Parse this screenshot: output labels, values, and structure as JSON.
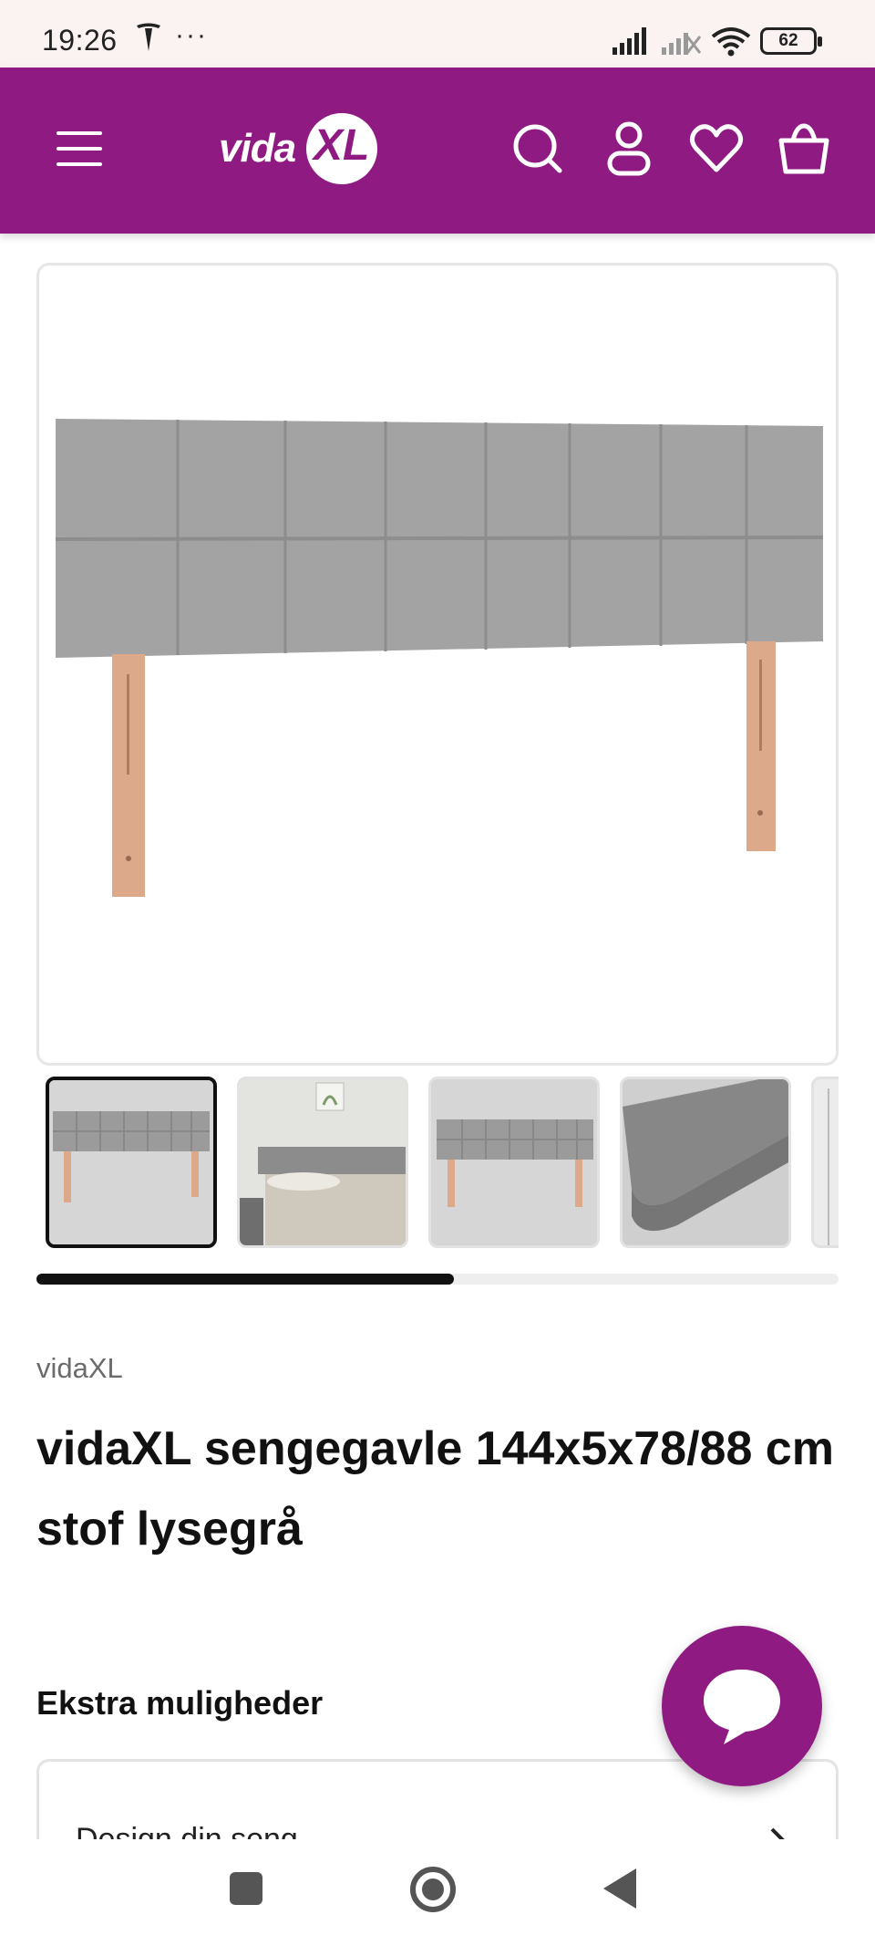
{
  "status_bar": {
    "time": "19:26",
    "more": "···",
    "battery": "62"
  },
  "header": {
    "logo_text": "vida",
    "logo_xl": "XL",
    "brand_color": "#8f1b82",
    "icons": [
      "menu-icon",
      "search-icon",
      "account-icon",
      "heart-icon",
      "basket-icon"
    ]
  },
  "gallery": {
    "thumbnails": [
      "headboard-front",
      "bedroom-scene",
      "headboard-front-alt",
      "fabric-detail",
      "partial-next"
    ],
    "active_index": 0,
    "scroll_progress": 0.52
  },
  "product": {
    "brand": "vidaXL",
    "title": "vidaXL sengegavle 144x5x78/88 cm stof lysegrå"
  },
  "extras": {
    "heading": "Ekstra muligheder",
    "option_label": "Design din seng"
  },
  "nav_bar": {
    "icons": [
      "recent-apps-icon",
      "home-icon",
      "back-icon"
    ]
  }
}
